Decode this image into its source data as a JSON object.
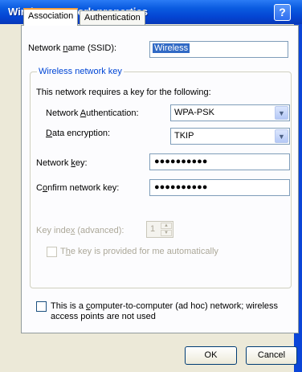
{
  "window": {
    "title": "Wireless network properties",
    "help": "?"
  },
  "tabs": [
    {
      "label": "Association",
      "active": true
    },
    {
      "label": "Authentication",
      "active": false
    }
  ],
  "association": {
    "ssid_label_pre": "Network ",
    "ssid_label_ul": "n",
    "ssid_label_post": "ame (SSID):",
    "ssid_value": "Wireless",
    "group_title": "Wireless network key",
    "requires_text": "This network requires a key for the following:",
    "auth_label_pre": "Network ",
    "auth_label_ul": "A",
    "auth_label_post": "uthentication:",
    "auth_value": "WPA-PSK",
    "enc_label_ul": "D",
    "enc_label_post": "ata encryption:",
    "enc_value": "TKIP",
    "key_label_pre": "Network ",
    "key_label_ul": "k",
    "key_label_post": "ey:",
    "key_value": "●●●●●●●●●●",
    "confirm_label_pre": "C",
    "confirm_label_ul": "o",
    "confirm_label_post": "nfirm network key:",
    "confirm_value": "●●●●●●●●●●",
    "key_index_label_pre": "Key inde",
    "key_index_label_ul": "x",
    "key_index_label_post": " (advanced):",
    "key_index_value": "1",
    "auto_key_pre": "T",
    "auto_key_ul": "h",
    "auto_key_post": "e key is provided for me automatically",
    "adhoc_line1_pre": "This is a ",
    "adhoc_line1_ul": "c",
    "adhoc_line1_post": "omputer-to-computer (ad hoc) network; wireless",
    "adhoc_line2": "access points are not used"
  },
  "buttons": {
    "ok": "OK",
    "cancel": "Cancel"
  },
  "colors": {
    "titlebar": "#0445d3",
    "client": "#ece9d8",
    "group_title": "#0046d5",
    "tab_highlight": "#f9a23b"
  }
}
